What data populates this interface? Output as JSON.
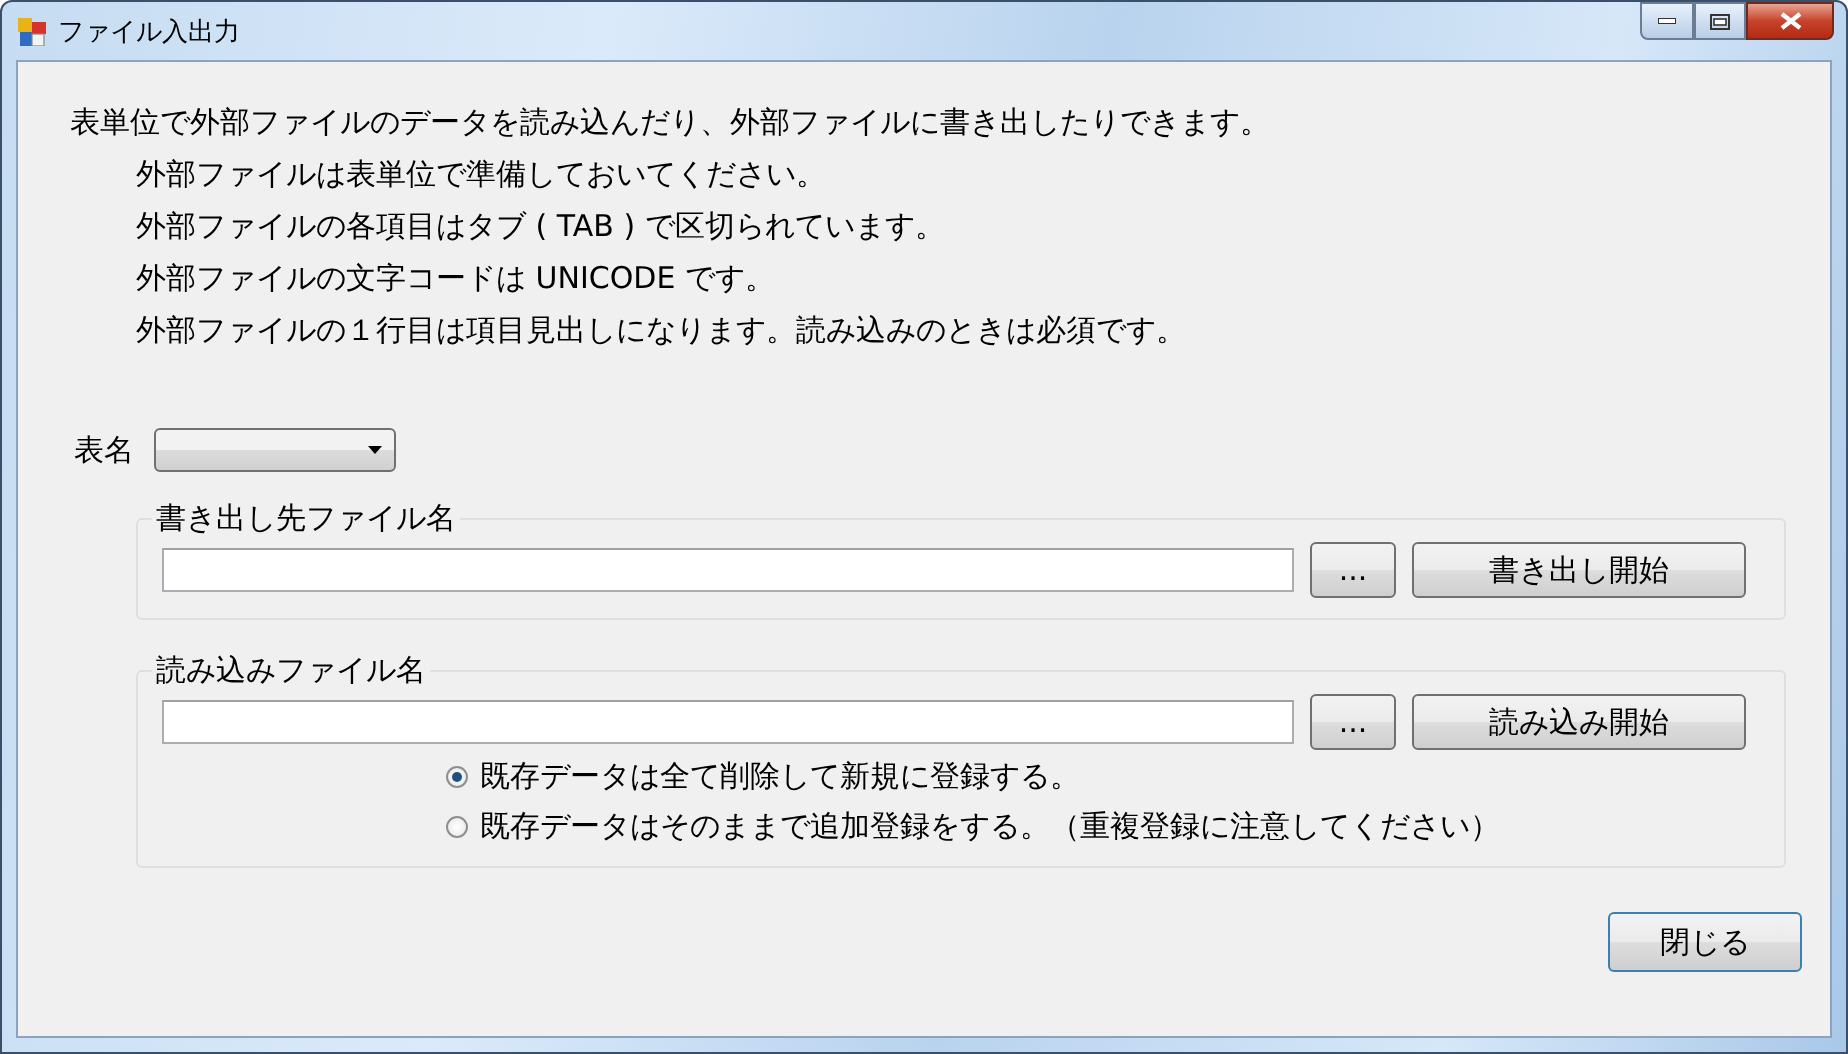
{
  "window": {
    "title": "ファイル入出力"
  },
  "intro": "表単位で外部ファイルのデータを読み込んだり、外部ファイルに書き出したりできます。",
  "notes": [
    "外部ファイルは表単位で準備しておいてください。",
    "外部ファイルの各項目はタブ ( TAB ) で区切られています。",
    "外部ファイルの文字コードは UNICODE です。",
    "外部ファイルの１行目は項目見出しになります。読み込みのときは必須です。"
  ],
  "table_name": {
    "label": "表名"
  },
  "export": {
    "legend": "書き出し先ファイル名",
    "browse_button": "...",
    "start_button": "書き出し開始"
  },
  "import": {
    "legend": "読み込みファイル名",
    "browse_button": "...",
    "start_button": "読み込み開始",
    "options": [
      {
        "label": "既存データは全て削除して新規に登録する。",
        "selected": true
      },
      {
        "label": "既存データはそのままで追加登録をする。（重複登録に注意してください）",
        "selected": false
      }
    ]
  },
  "close_button": "閉じる"
}
